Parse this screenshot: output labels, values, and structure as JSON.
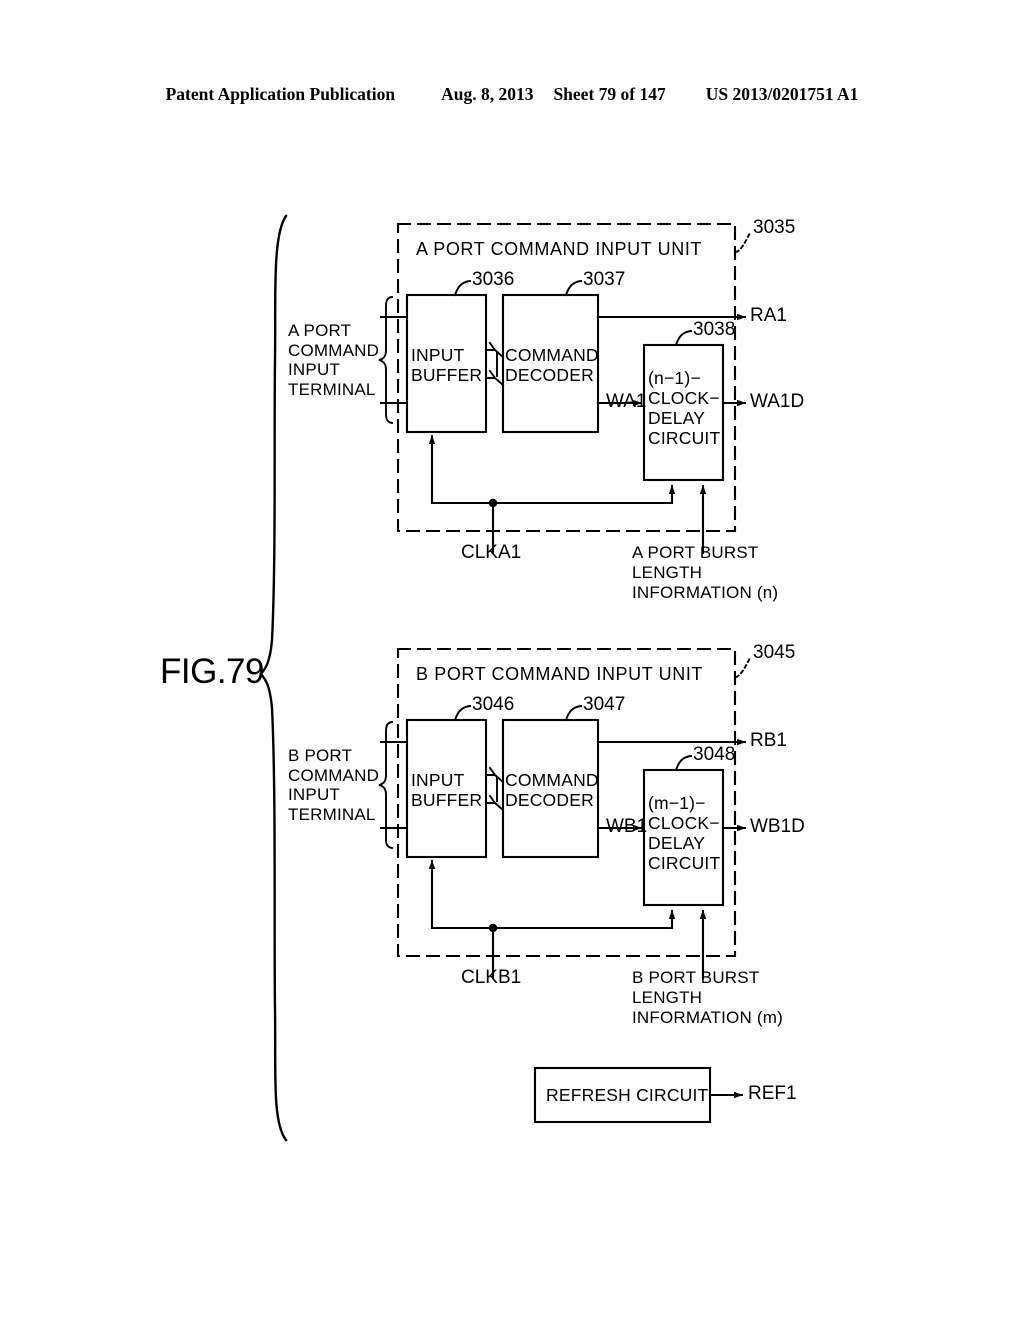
{
  "header": {
    "publication": "Patent Application Publication",
    "date": "Aug. 8, 2013",
    "sheet": "Sheet 79 of 147",
    "patent_number": "US 2013/0201751 A1"
  },
  "figure": {
    "label": "FIG.79"
  },
  "diagrams": [
    {
      "id": "a-port",
      "unit_title": "A PORT COMMAND INPUT UNIT",
      "unit_ref": "3035",
      "terminal_label": "A PORT\nCOMMAND\nINPUT\nTERMINAL",
      "input_buffer": {
        "label": "INPUT\nBUFFER",
        "ref": "3036"
      },
      "command_decoder": {
        "label": "COMMAND\nDECODER",
        "ref": "3037"
      },
      "delay_circuit": {
        "label": "(n−1)−\nCLOCK−\nDELAY\nCIRCUIT",
        "ref": "3038"
      },
      "signal_out_top": "RA1",
      "signal_mid": "WA1",
      "signal_out_mid": "WA1D",
      "clock_label": "CLKA1",
      "burst_label": "A PORT BURST\nLENGTH\nINFORMATION (n)"
    },
    {
      "id": "b-port",
      "unit_title": "B PORT COMMAND INPUT UNIT",
      "unit_ref": "3045",
      "terminal_label": "B PORT\nCOMMAND\nINPUT\nTERMINAL",
      "input_buffer": {
        "label": "INPUT\nBUFFER",
        "ref": "3046"
      },
      "command_decoder": {
        "label": "COMMAND\nDECODER",
        "ref": "3047"
      },
      "delay_circuit": {
        "label": "(m−1)−\nCLOCK−\nDELAY\nCIRCUIT",
        "ref": "3048"
      },
      "signal_out_top": "RB1",
      "signal_mid": "WB1",
      "signal_out_mid": "WB1D",
      "clock_label": "CLKB1",
      "burst_label": "B PORT BURST\nLENGTH\nINFORMATION (m)"
    }
  ],
  "refresh": {
    "label": "REFRESH CIRCUIT",
    "output": "REF1"
  }
}
